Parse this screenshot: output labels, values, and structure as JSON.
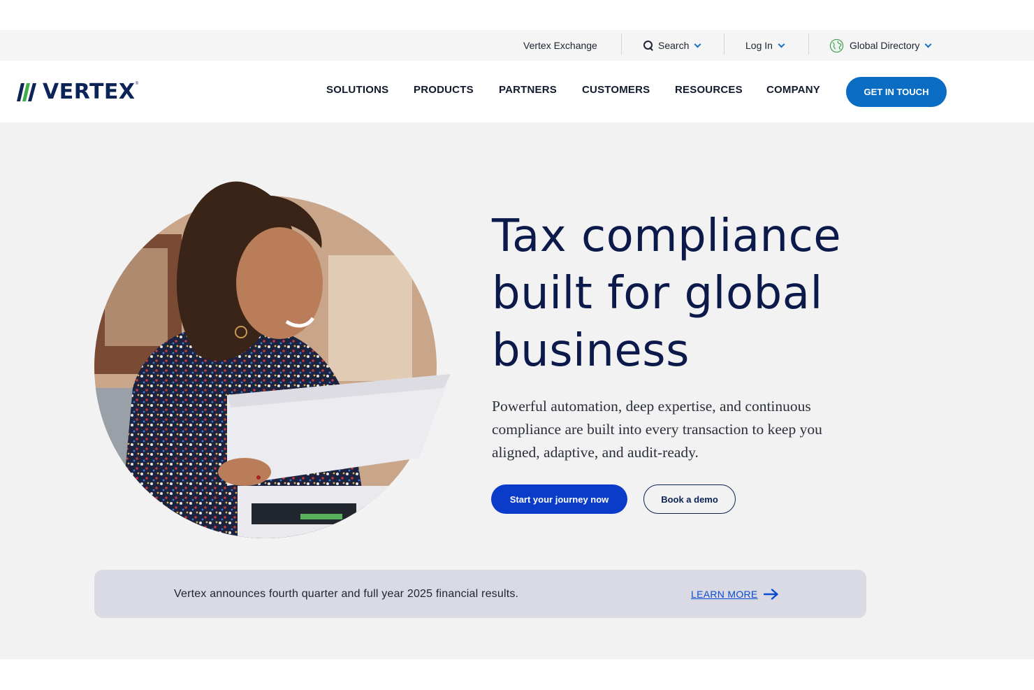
{
  "utility": {
    "exchange": "Vertex Exchange",
    "search": "Search",
    "login": "Log In",
    "directory": "Global Directory"
  },
  "brand": {
    "name": "VERTEX",
    "tm": "®",
    "colors": {
      "navy": "#0b2356",
      "green": "#3fae49",
      "blue": "#0a6cc2"
    }
  },
  "nav": {
    "items": [
      "SOLUTIONS",
      "PRODUCTS",
      "PARTNERS",
      "CUSTOMERS",
      "RESOURCES",
      "COMPANY"
    ],
    "cta": "GET IN TOUCH"
  },
  "hero": {
    "title_lines": [
      "Tax compliance",
      "built for global",
      "business"
    ],
    "description": "Powerful automation, deep expertise, and continuous compliance are built into every transaction to keep you aligned, adaptive, and audit-ready.",
    "primary_cta": "Start your journey now",
    "secondary_cta": "Book a demo",
    "image_icon": "person-reviewing-document-photo"
  },
  "announcement": {
    "text": "Vertex announces fourth quarter and full year 2025 financial results.",
    "link": "LEARN MORE",
    "link_icon": "arrow-right-icon"
  }
}
